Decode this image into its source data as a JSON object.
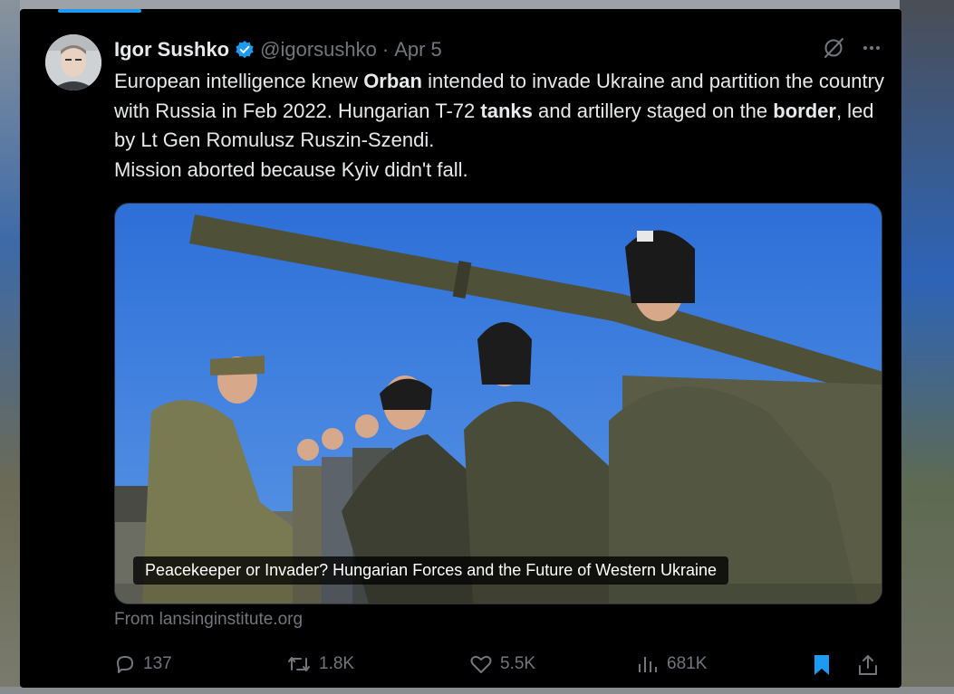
{
  "author": {
    "name": "Igor Sushko",
    "handle": "@igorsushko",
    "separator": "·",
    "date": "Apr 5"
  },
  "tweet": {
    "p1": "European intelligence knew ",
    "b1": "Orban",
    "p2": " intended to invade Ukraine and partition the country with Russia in Feb 2022. Hungarian T-72 ",
    "b2": "tanks",
    "p3": " and artillery staged on the ",
    "b3": "border",
    "p4": ", led by Lt Gen Romulusz Ruszin-Szendi.",
    "line2": "Mission aborted because Kyiv didn't fall."
  },
  "media": {
    "caption": "Peacekeeper or Invader? Hungarian Forces and the Future of Western Ukraine",
    "source": "From lansinginstitute.org"
  },
  "actions": {
    "replies": "137",
    "reposts": "1.8K",
    "likes": "5.5K",
    "views": "681K"
  },
  "colors": {
    "accent": "#1d9bf0",
    "text": "#e7e9ea",
    "muted": "#71767b",
    "background": "#000000"
  },
  "icons": [
    "verified-badge-icon",
    "grok-icon",
    "more-icon",
    "reply-icon",
    "repost-icon",
    "like-icon",
    "views-icon",
    "bookmark-icon",
    "share-icon"
  ]
}
